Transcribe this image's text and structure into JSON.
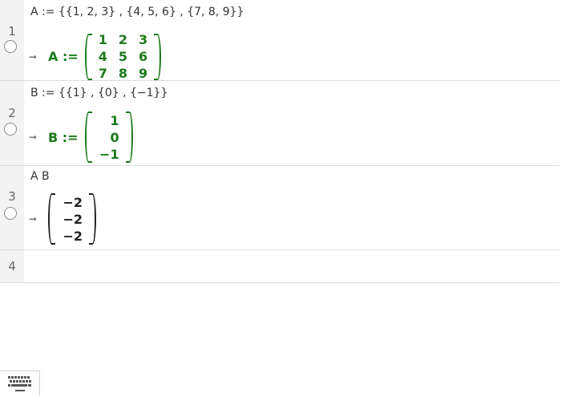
{
  "algebra": {
    "rows": [
      {
        "number": "1",
        "input": "A := {{1, 2, 3} , {4, 5, 6} , {7, 8, 9}}",
        "output_label": "A :=",
        "matrix": [
          [
            "1",
            "2",
            "3"
          ],
          [
            "4",
            "5",
            "6"
          ],
          [
            "7",
            "8",
            "9"
          ]
        ]
      },
      {
        "number": "2",
        "input": "B := {{1} , {0} , {−1}}",
        "output_label": "B :=",
        "matrix": [
          [
            "1"
          ],
          [
            "0"
          ],
          [
            "−1"
          ]
        ]
      },
      {
        "number": "3",
        "input": "A B",
        "output_label": "",
        "matrix": [
          [
            "−2"
          ],
          [
            "−2"
          ],
          [
            "−2"
          ]
        ]
      },
      {
        "number": "4",
        "input": ""
      }
    ]
  },
  "icons": {
    "output_arrow": "arrow-right-icon",
    "visibility": "visibility-toggle-icon",
    "keyboard": "keyboard-icon"
  },
  "colors": {
    "object_green": "#1b7a1b",
    "gutter": "#f3f3f3",
    "divider": "#dcdcdc"
  }
}
